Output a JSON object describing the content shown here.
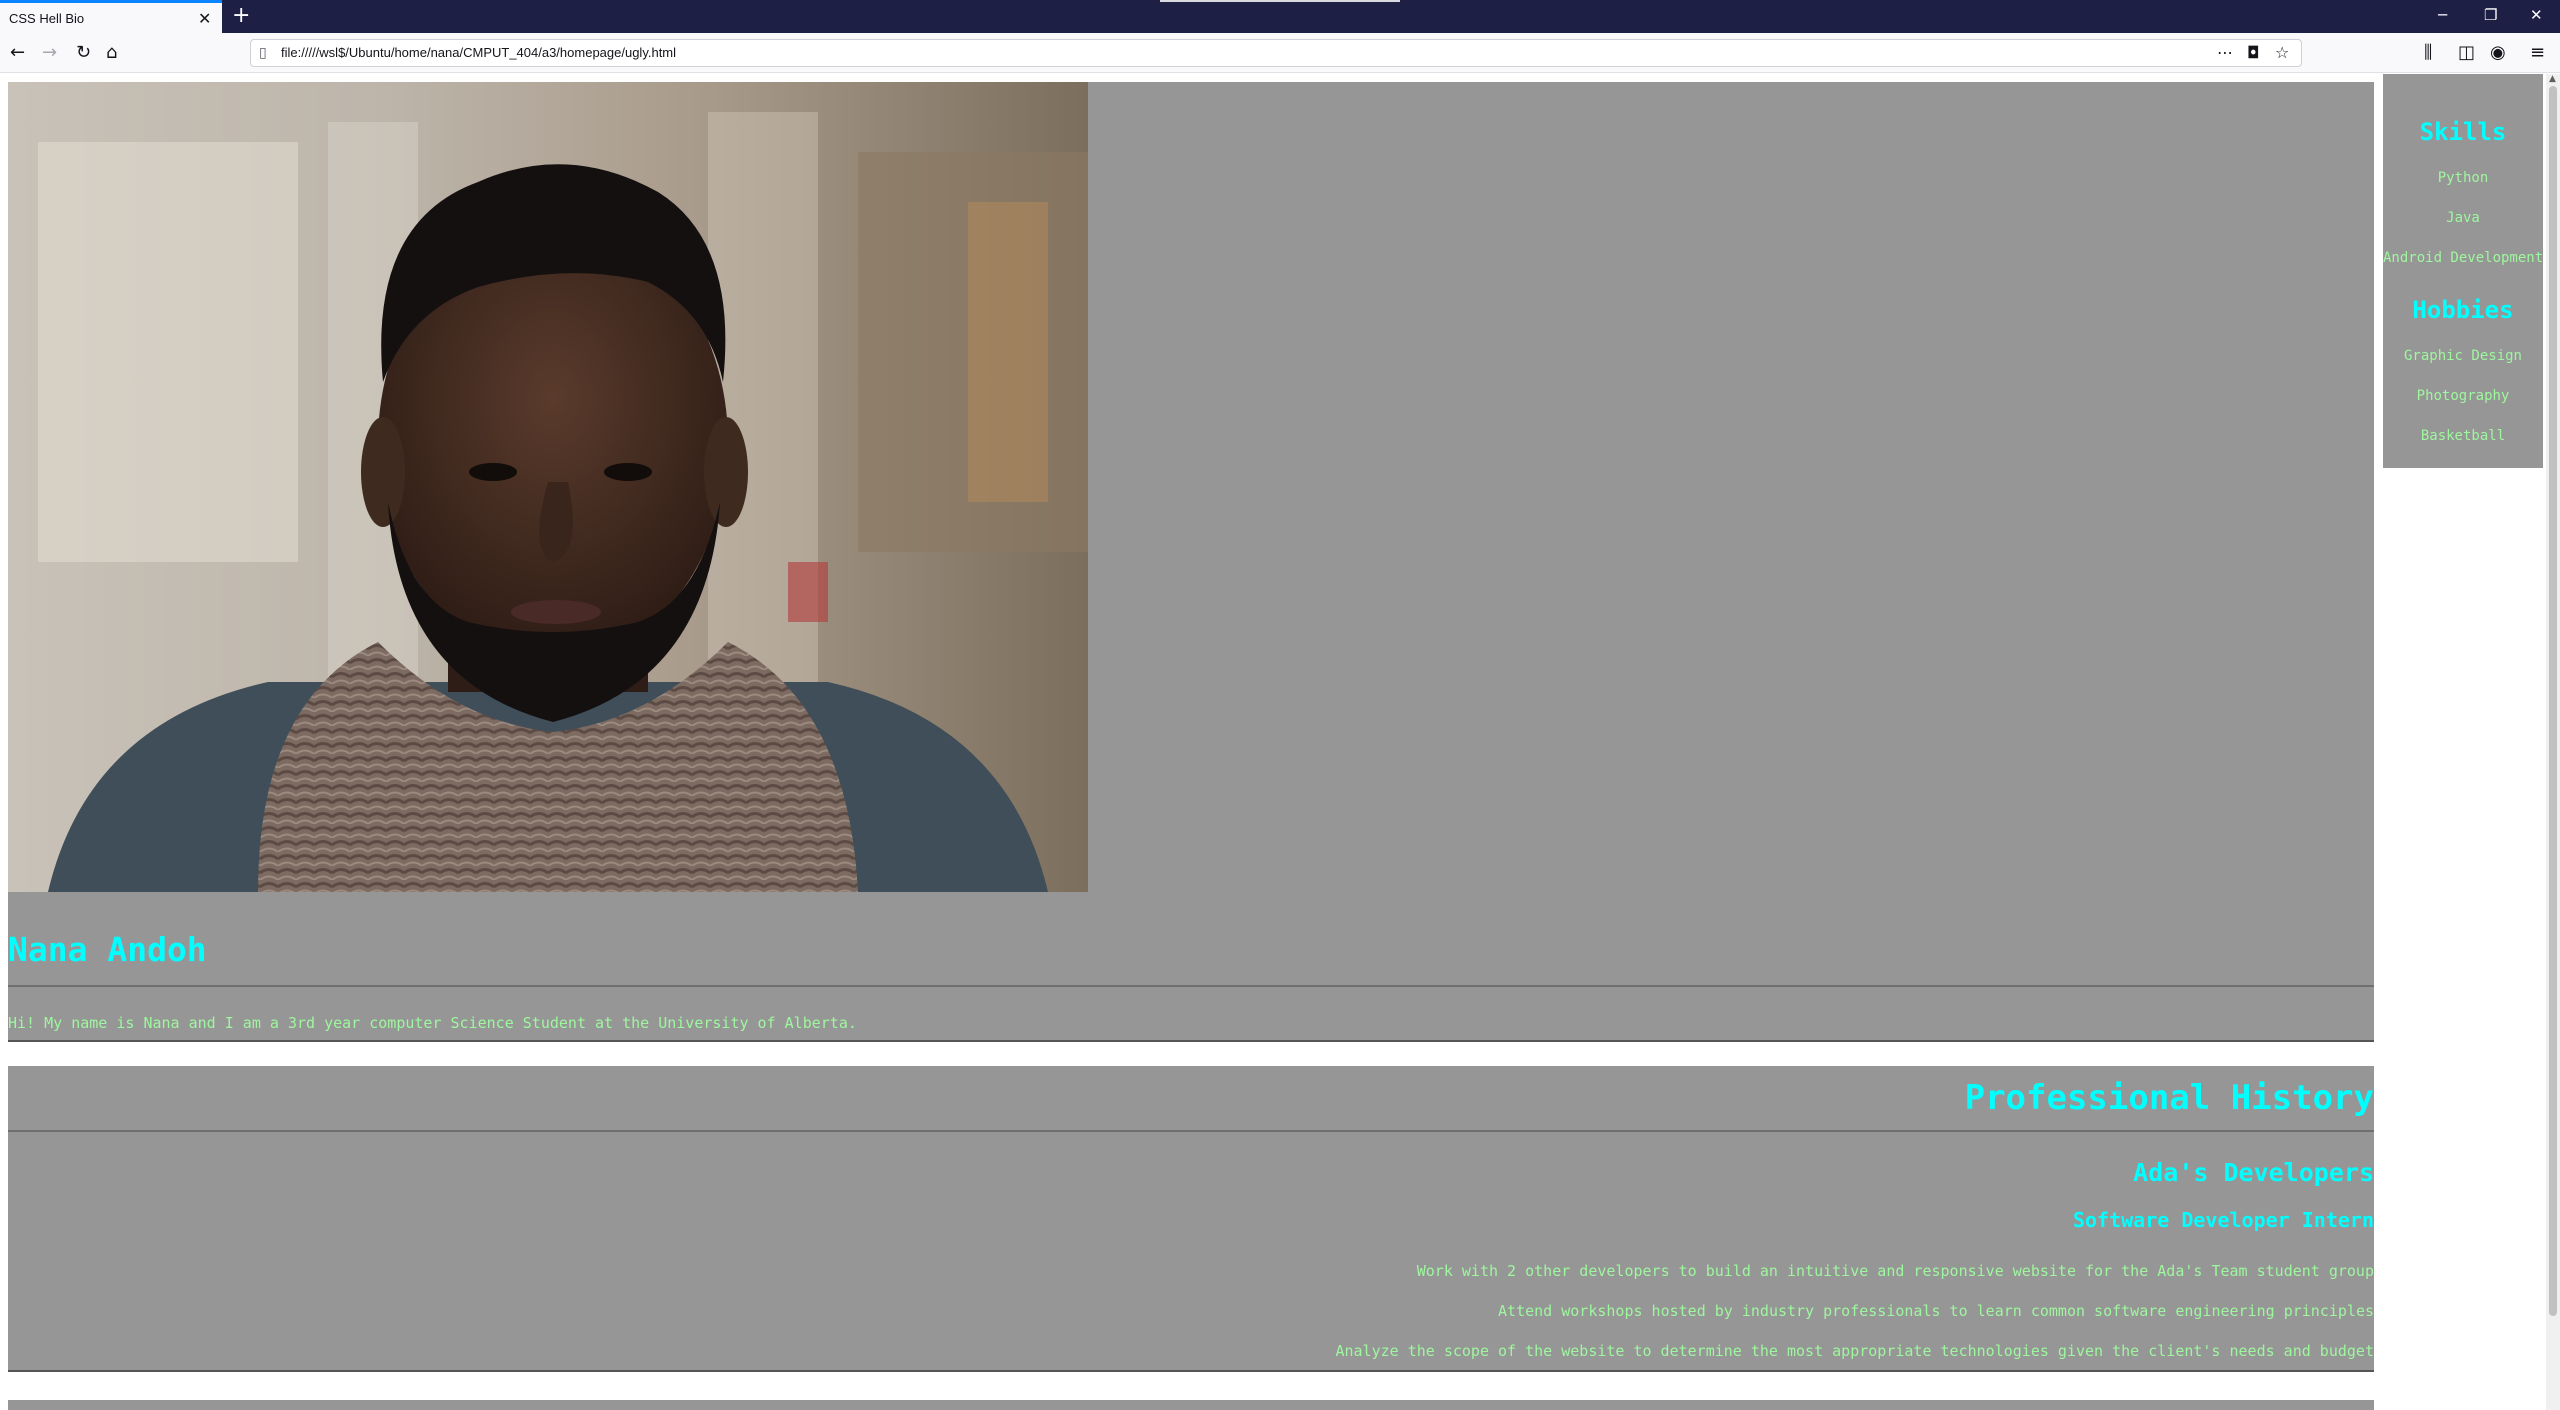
{
  "browser": {
    "tab_title": "CSS Hell Bio",
    "url": "file://///wsl$/Ubuntu/home/nana/CMPUT_404/a3/homepage/ugly.html"
  },
  "bio": {
    "name": "Nana Andoh",
    "intro": "Hi! My name is Nana and I am a 3rd year computer Science Student at the University of Alberta."
  },
  "history": {
    "title": "Professional History",
    "company": "Ada's Developers",
    "role": "Software Developer Intern",
    "duties": [
      "Work with 2 other developers to build an intuitive and responsive website for the Ada's Team student group",
      "Attend workshops hosted by industry professionals to learn common software engineering principles",
      "Analyze the scope of the website to determine the most appropriate technologies given the client's needs and budget"
    ]
  },
  "sidebar": {
    "skills_heading": "Skills",
    "skills": [
      "Python",
      "Java",
      "Android Development"
    ],
    "hobbies_heading": "Hobbies",
    "hobbies": [
      "Graphic Design",
      "Photography",
      "Basketball"
    ]
  },
  "colors": {
    "panel_bg": "#969696",
    "heading": "#00ffff",
    "body_text": "#9ef79e",
    "tabbar": "#1d1f45"
  },
  "icons": [
    "back-icon",
    "forward-icon",
    "reload-icon",
    "home-icon",
    "page-icon",
    "more-icon",
    "pocket-icon",
    "bookmark-star-icon",
    "library-icon",
    "sidebar-icon",
    "account-icon",
    "menu-icon"
  ]
}
